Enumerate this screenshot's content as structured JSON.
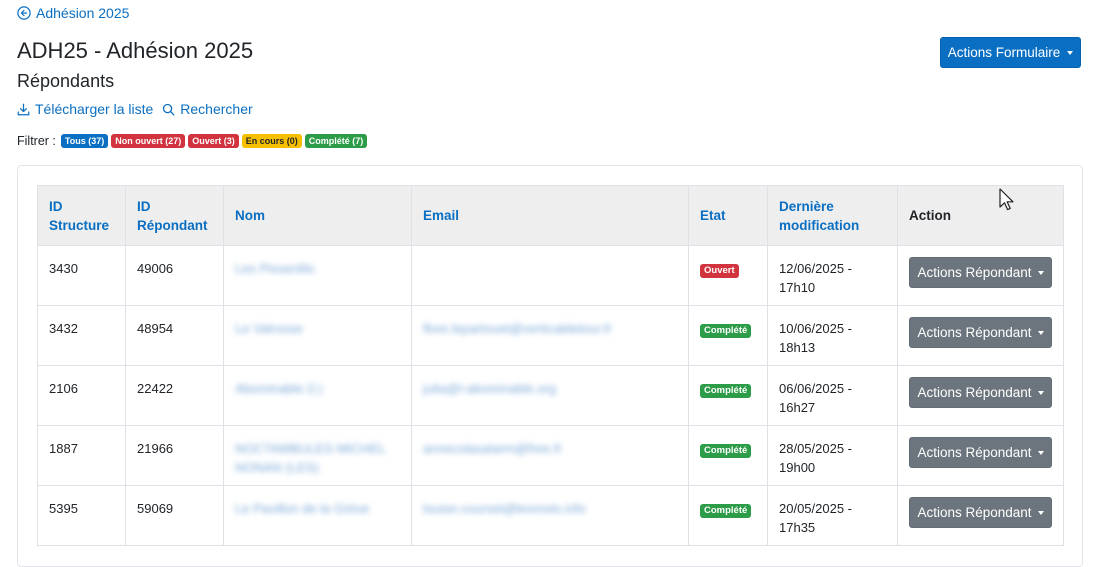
{
  "back_link": {
    "label": "Adhésion 2025"
  },
  "header": {
    "title": "ADH25 - Adhésion 2025",
    "subtitle": "Répondants",
    "actions_button": "Actions Formulaire"
  },
  "tools": {
    "download": "Télécharger la liste",
    "search": "Rechercher"
  },
  "filter": {
    "label": "Filtrer :",
    "badges": [
      {
        "label": "Tous (37)",
        "color": "#0a6fc2"
      },
      {
        "label": "Non ouvert (27)",
        "color": "#d1343f"
      },
      {
        "label": "Ouvert (3)",
        "color": "#d1343f"
      },
      {
        "label": "En cours (0)",
        "color": "#f6c000"
      },
      {
        "label": "Complété (7)",
        "color": "#2c9c48"
      }
    ]
  },
  "table": {
    "headers": [
      "ID Structure",
      "ID Répondant",
      "Nom",
      "Email",
      "Etat",
      "Dernière modification",
      "Action"
    ],
    "rows": [
      {
        "id_structure": "3430",
        "id_repondant": "49006",
        "nom": "Les Pissenlits",
        "email": "",
        "etat": "Ouvert",
        "etat_color": "#d1343f",
        "date_line1": "12/06/2025 -",
        "date_line2": "17h10",
        "action": "Actions Répondant"
      },
      {
        "id_structure": "3432",
        "id_repondant": "48954",
        "nom": "Le Valrosse",
        "email": "flore.lepartouet@verticaldetour.fr",
        "etat": "Complété",
        "etat_color": "#2c9c48",
        "date_line1": "10/06/2025 -",
        "date_line2": "18h13",
        "action": "Actions Répondant"
      },
      {
        "id_structure": "2106",
        "id_repondant": "22422",
        "nom": "Abominable (l.)",
        "email": "julia@l-abominable.org",
        "etat": "Complété",
        "etat_color": "#2c9c48",
        "date_line1": "06/06/2025 -",
        "date_line2": "16h27",
        "action": "Actions Répondant"
      },
      {
        "id_structure": "1887",
        "id_repondant": "21966",
        "nom": "NOCTAMBULES MICHEL NONAN (LES)",
        "email": "annecolasalarm@free.fr",
        "etat": "Complété",
        "etat_color": "#2c9c48",
        "date_line1": "28/05/2025 -",
        "date_line2": "19h00",
        "action": "Actions Répondant"
      },
      {
        "id_structure": "5395",
        "id_repondant": "59069",
        "nom": "Le Pavillon de la Grève",
        "email": "louise.courset@lesmots.info",
        "etat": "Complété",
        "etat_color": "#2c9c48",
        "date_line1": "20/05/2025 -",
        "date_line2": "17h35",
        "action": "Actions Répondant"
      }
    ]
  }
}
